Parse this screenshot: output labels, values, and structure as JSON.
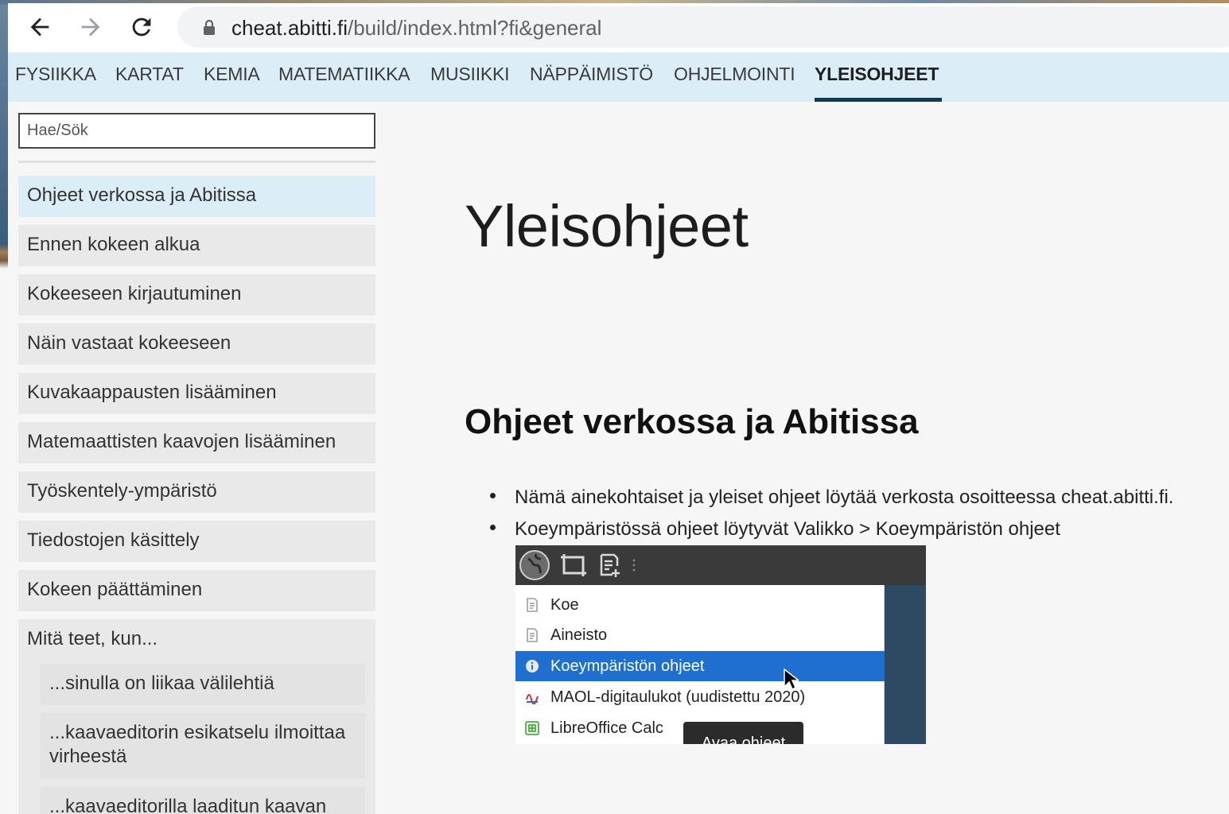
{
  "browser": {
    "url_host": "cheat.abitti.fi",
    "url_path": "/build/index.html?fi&general"
  },
  "topnav": {
    "items": [
      "FYSIIKKA",
      "KARTAT",
      "KEMIA",
      "MATEMATIIKKA",
      "MUSIIKKI",
      "NÄPPÄIMISTÖ",
      "OHJELMOINTI",
      "YLEISOHJEET"
    ],
    "active": "YLEISOHJEET"
  },
  "sidebar": {
    "search_placeholder": "Hae/Sök",
    "items": [
      "Ohjeet verkossa ja Abitissa",
      "Ennen kokeen alkua",
      "Kokeeseen kirjautuminen",
      "Näin vastaat kokeeseen",
      "Kuvakaappausten lisääminen",
      "Matemaattisten kaavojen lisääminen",
      "Työskentely-ympäristö",
      "Tiedostojen käsittely",
      "Kokeen päättäminen",
      "Mitä teet, kun..."
    ],
    "subitems": [
      "...sinulla on liikaa välilehtiä",
      "...kaavaeditorin esikatselu ilmoittaa virheestä",
      "...kaavaeditorilla laaditun kaavan"
    ]
  },
  "main": {
    "title": "Yleisohjeet",
    "section_title": "Ohjeet verkossa ja Abitissa",
    "bullets": [
      "Nämä ainekohtaiset ja yleiset ohjeet löytää verkosta osoitteessa cheat.abitti.fi.",
      "Koeympäristössä ohjeet löytyvät Valikko > Koeympäristön ohjeet"
    ],
    "screenshot": {
      "menu": [
        "Koe",
        "Aineisto",
        "Koeympäristön ohjeet",
        "MAOL-digitaulukot (uudistettu 2020)",
        "LibreOffice Calc"
      ],
      "selected": "Koeympäristön ohjeet",
      "tooltip": "Avaa ohjeet"
    }
  },
  "colors": {
    "nav_bg": "#dbeef8",
    "active_underline": "#0f3b5a",
    "menu_selected": "#1f6fd1"
  }
}
